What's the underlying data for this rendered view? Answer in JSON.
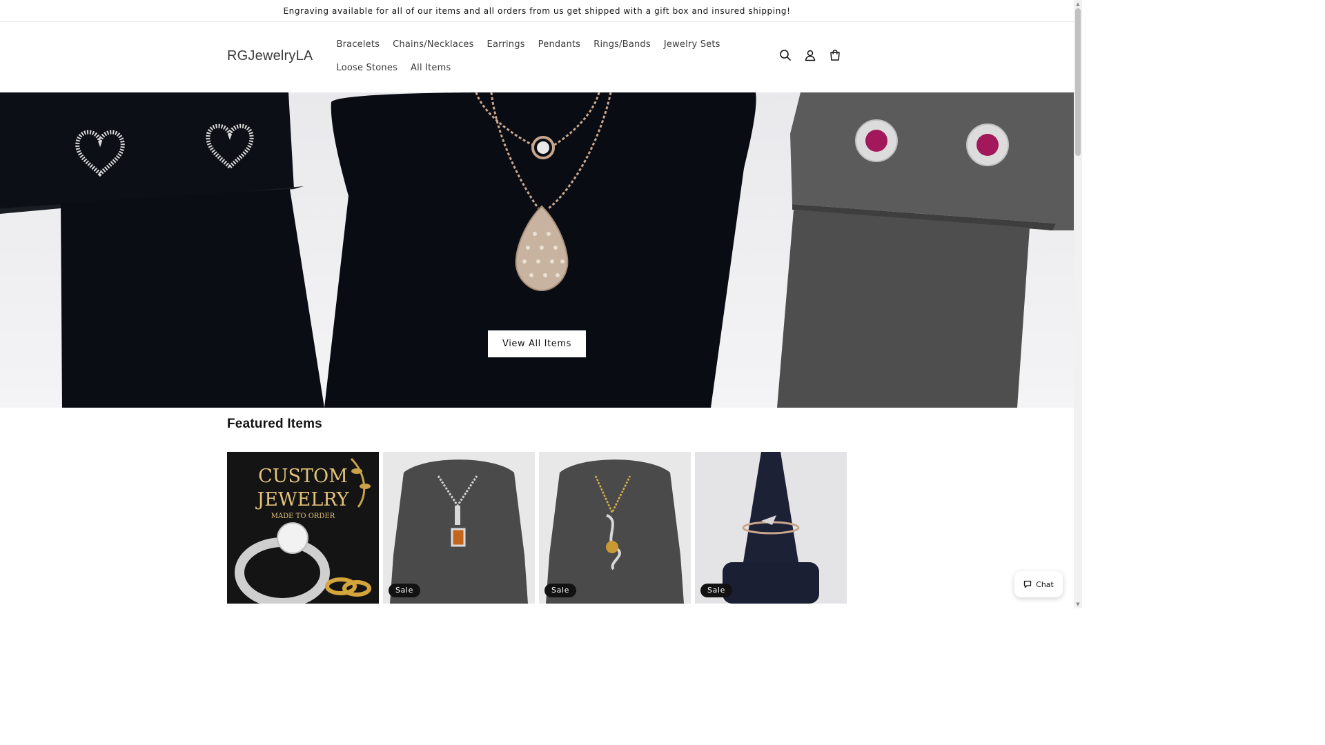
{
  "announcement": "Engraving available for all of our items and all orders from us get shipped with a gift box and insured shipping!",
  "header": {
    "logo": "RGJewelryLA",
    "nav": [
      "Bracelets",
      "Chains/Necklaces",
      "Earrings",
      "Pendants",
      "Rings/Bands",
      "Jewelry Sets",
      "Loose Stones",
      "All Items"
    ],
    "icons": [
      "search-icon",
      "account-icon",
      "cart-icon"
    ]
  },
  "hero": {
    "button_label": "View All Items"
  },
  "featured": {
    "title": "Featured Items",
    "cards": [
      {
        "image_text_1": "CUSTOM",
        "image_text_2": "JEWELRY",
        "image_text_3": "MADE TO ORDER",
        "badge": ""
      },
      {
        "badge": "Sale"
      },
      {
        "badge": "Sale"
      },
      {
        "badge": "Sale"
      }
    ]
  },
  "chat": {
    "label": "Chat"
  },
  "colors": {
    "text": "#121212",
    "badge_bg": "#121212",
    "hero_button_bg": "#ffffff"
  }
}
